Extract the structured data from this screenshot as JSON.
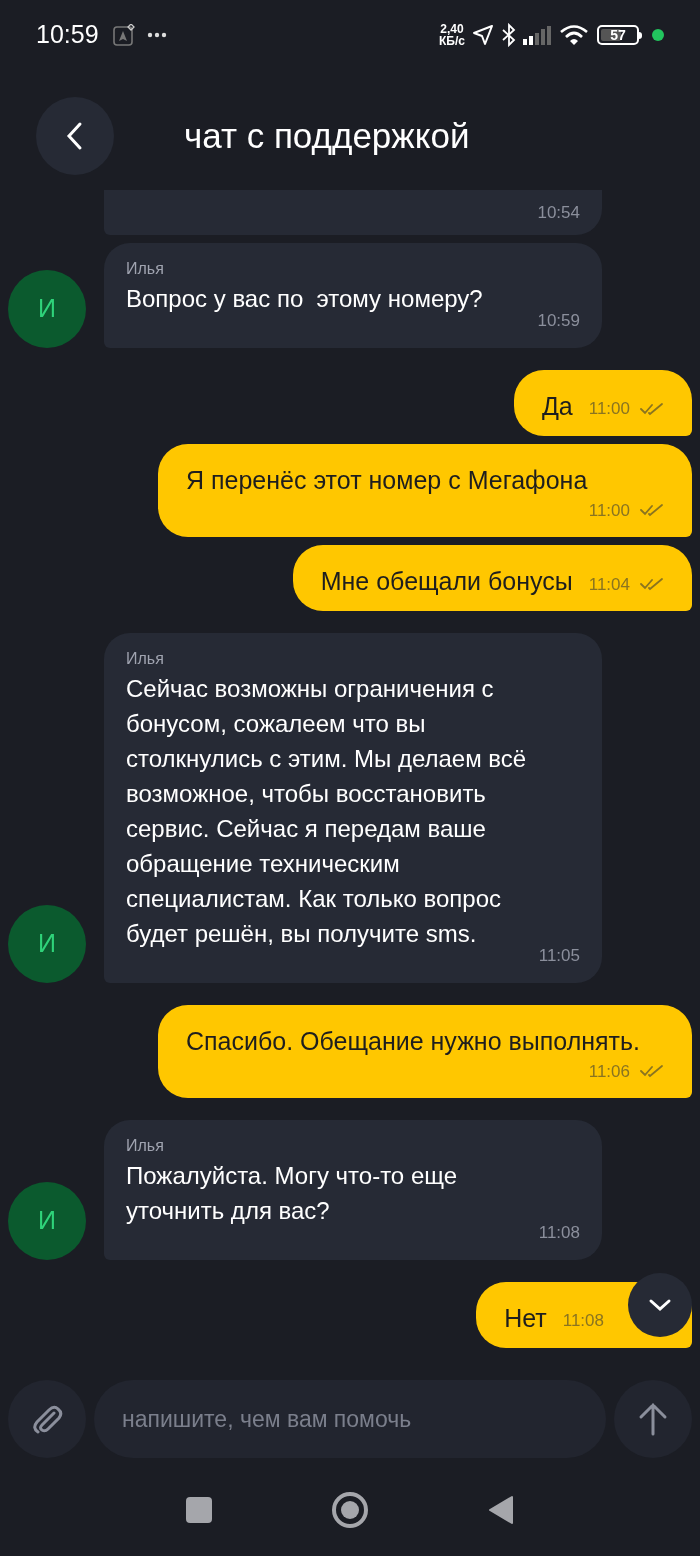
{
  "status_bar": {
    "time": "10:59",
    "net_speed": "2,40",
    "net_speed_unit": "КБ/с",
    "battery": "57"
  },
  "header": {
    "title": "чат с поддержкой"
  },
  "messages": [
    {
      "kind": "incoming",
      "time": "10:54"
    },
    {
      "kind": "incoming",
      "avatar": "И",
      "sender": "Илья",
      "text": "Вопрос у вас по  этому номеру?",
      "time": "10:59"
    },
    {
      "kind": "outgoing",
      "text": "Да",
      "time": "11:00",
      "read": true
    },
    {
      "kind": "outgoing",
      "text": "Я перенёс этот номер с Мегафона",
      "time": "11:00",
      "read": true
    },
    {
      "kind": "outgoing",
      "text": "Мне обещали бонусы",
      "time": "11:04",
      "read": true
    },
    {
      "kind": "incoming",
      "avatar": "И",
      "sender": "Илья",
      "text": "Сейчас возможны ограничения с бонусом, сожалеем что вы столкнулись с этим. Мы делаем всё возможное, чтобы восстановить сервис. Сейчас я передам ваше обращение техническим специалистам. Как только вопрос будет решён, вы получите sms.",
      "time": "11:05"
    },
    {
      "kind": "outgoing",
      "text": "Спасибо. Обещание нужно выполнять.",
      "time": "11:06",
      "read": true
    },
    {
      "kind": "incoming",
      "avatar": "И",
      "sender": "Илья",
      "text": "Пожалуйста. Могу что-то еще уточнить для вас?",
      "time": "11:08"
    },
    {
      "kind": "outgoing",
      "text": "Нет",
      "time": "11:08"
    }
  ],
  "composer": {
    "placeholder": "напишите, чем вам помочь"
  }
}
